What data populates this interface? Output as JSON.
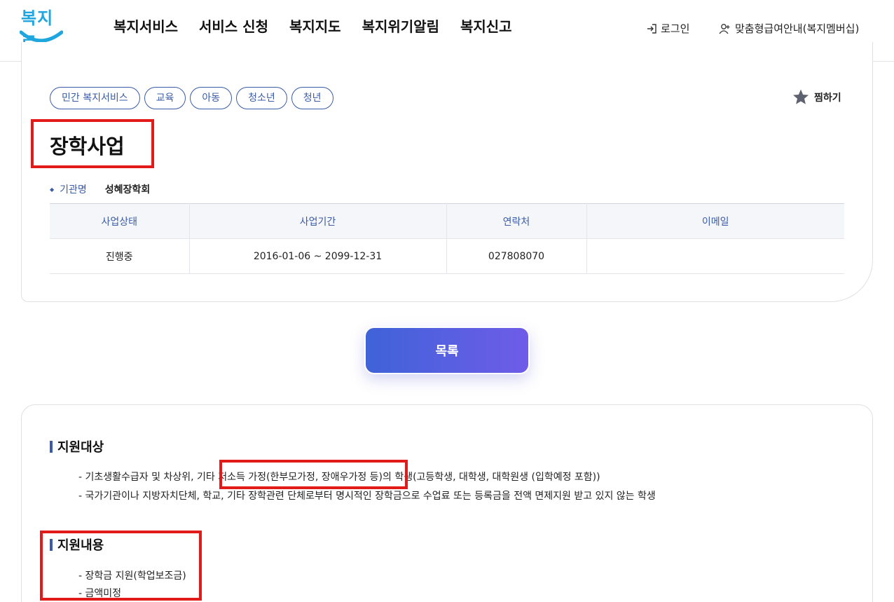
{
  "header": {
    "logo_text": "복지로",
    "nav": [
      "복지서비스",
      "서비스 신청",
      "복지지도",
      "복지위기알림",
      "복지신고"
    ],
    "login_label": "로그인",
    "member_label": "맞춤형급여안내(복지멤버십)"
  },
  "service": {
    "tags": [
      "민간 복지서비스",
      "교육",
      "아동",
      "청소년",
      "청년"
    ],
    "favorite_label": "찜하기",
    "title": "장학사업",
    "org_label": "기관명",
    "org_name": "성혜장학회",
    "table": {
      "headers": [
        "사업상태",
        "사업기간",
        "연락처",
        "이메일"
      ],
      "row": [
        "진행중",
        "2016-01-06 ~ 2099-12-31",
        "027808070",
        ""
      ]
    }
  },
  "list_button": "목록",
  "detail": {
    "target_title": "지원대상",
    "target_lines": [
      "- 기초생활수급자 및 차상위, 기타 저소득 가정(한부모가정, 장애우가정 등)의 학생(고등학생, 대학생, 대학원생 (입학예정 포함))",
      "- 국가기관이나 지방자치단체, 학교, 기타 장학관련 단체로부터 명시적인 장학금으로 수업료 또는 등록금을 전액 면제지원 받고 있지 않는 학생"
    ],
    "content_title": "지원내용",
    "content_lines": [
      "- 장학금 지원(학업보조금)",
      "- 금액미정"
    ]
  },
  "colors": {
    "accent": "#3a5ba8",
    "highlight_box": "#e21a1a",
    "button_gradient_start": "#3f63d8",
    "button_gradient_end": "#6f5ce8",
    "logo": "#1fa6de"
  }
}
